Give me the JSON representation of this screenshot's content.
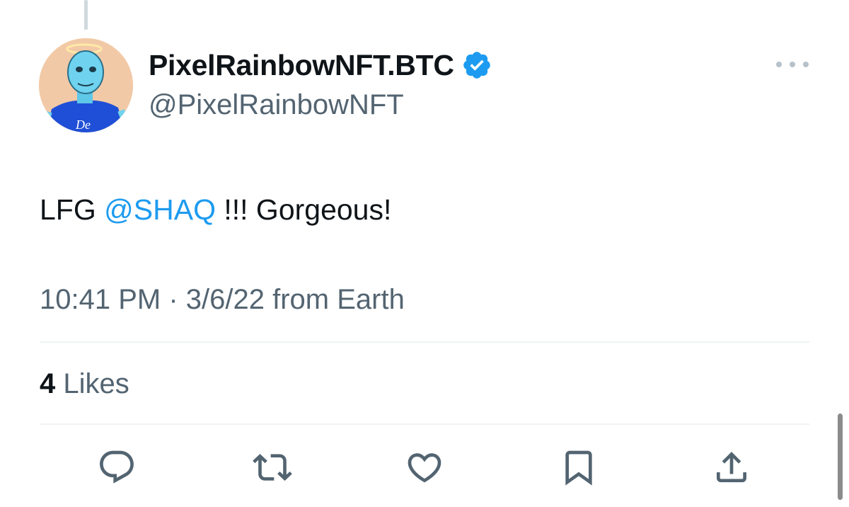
{
  "tweet": {
    "display_name": "PixelRainbowNFT.BTC",
    "handle": "@PixelRainbowNFT",
    "text_prefix": "LFG ",
    "mention": "@SHAQ",
    "text_suffix": " !!! Gorgeous!",
    "time": "10:41 PM",
    "separator": " · ",
    "date": "3/6/22",
    "source": " from Earth",
    "likes_count": "4",
    "likes_label": " Likes",
    "avatar_shirt_text": "De"
  },
  "icons": {
    "verified": "verified-badge-icon",
    "more": "more-options-icon",
    "reply": "reply-icon",
    "retweet": "retweet-icon",
    "like": "heart-icon",
    "bookmark": "bookmark-icon",
    "share": "share-icon"
  },
  "colors": {
    "text_primary": "#0f1419",
    "text_secondary": "#536471",
    "link": "#1d9bf0",
    "verified": "#1d9bf0",
    "action_icons": "#536471",
    "divider": "#eff3f4"
  }
}
